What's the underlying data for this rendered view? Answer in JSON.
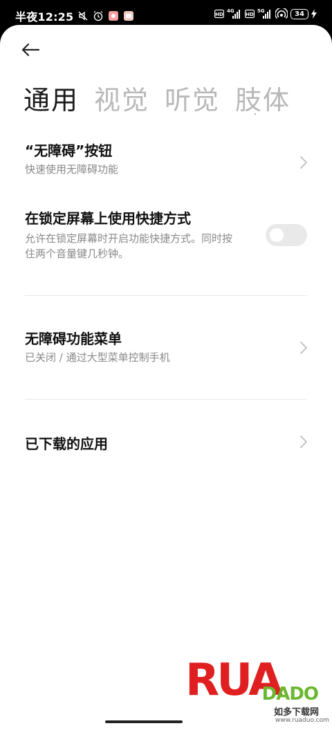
{
  "status_bar": {
    "time": "半夜12:25",
    "network_hd1": "HD",
    "network_4g": "4G",
    "network_hd2": "HD",
    "network_5g": "5G",
    "battery": "34"
  },
  "tabs": [
    {
      "label": "通用",
      "active": true
    },
    {
      "label": "视觉",
      "active": false
    },
    {
      "label": "听觉",
      "active": false
    },
    {
      "label": "肢体",
      "active": false
    }
  ],
  "items": {
    "accessibility_button": {
      "title": "“无障碍”按钮",
      "subtitle": "快速使用无障碍功能"
    },
    "lock_screen_shortcut": {
      "title": "在锁定屏幕上使用快捷方式",
      "subtitle_line1": "允许在锁定屏幕时开启功能快捷方式。同时按",
      "subtitle_line2": "住两个音量键几秒钟。",
      "toggle_on": false
    },
    "accessibility_menu": {
      "title": "无障碍功能菜单",
      "subtitle": "已关闭 / 通过大型菜单控制手机"
    },
    "downloaded_apps": {
      "title": "已下载的应用"
    }
  },
  "watermark": {
    "brand_big": "RUA",
    "brand_small": "DADO",
    "brand_cn": "如多下载网",
    "brand_url": "www.ruaduo.com"
  },
  "colors": {
    "accent_green": "#6ab82f",
    "brand_red": "#e02020",
    "brand_orange": "#f08a1c"
  }
}
